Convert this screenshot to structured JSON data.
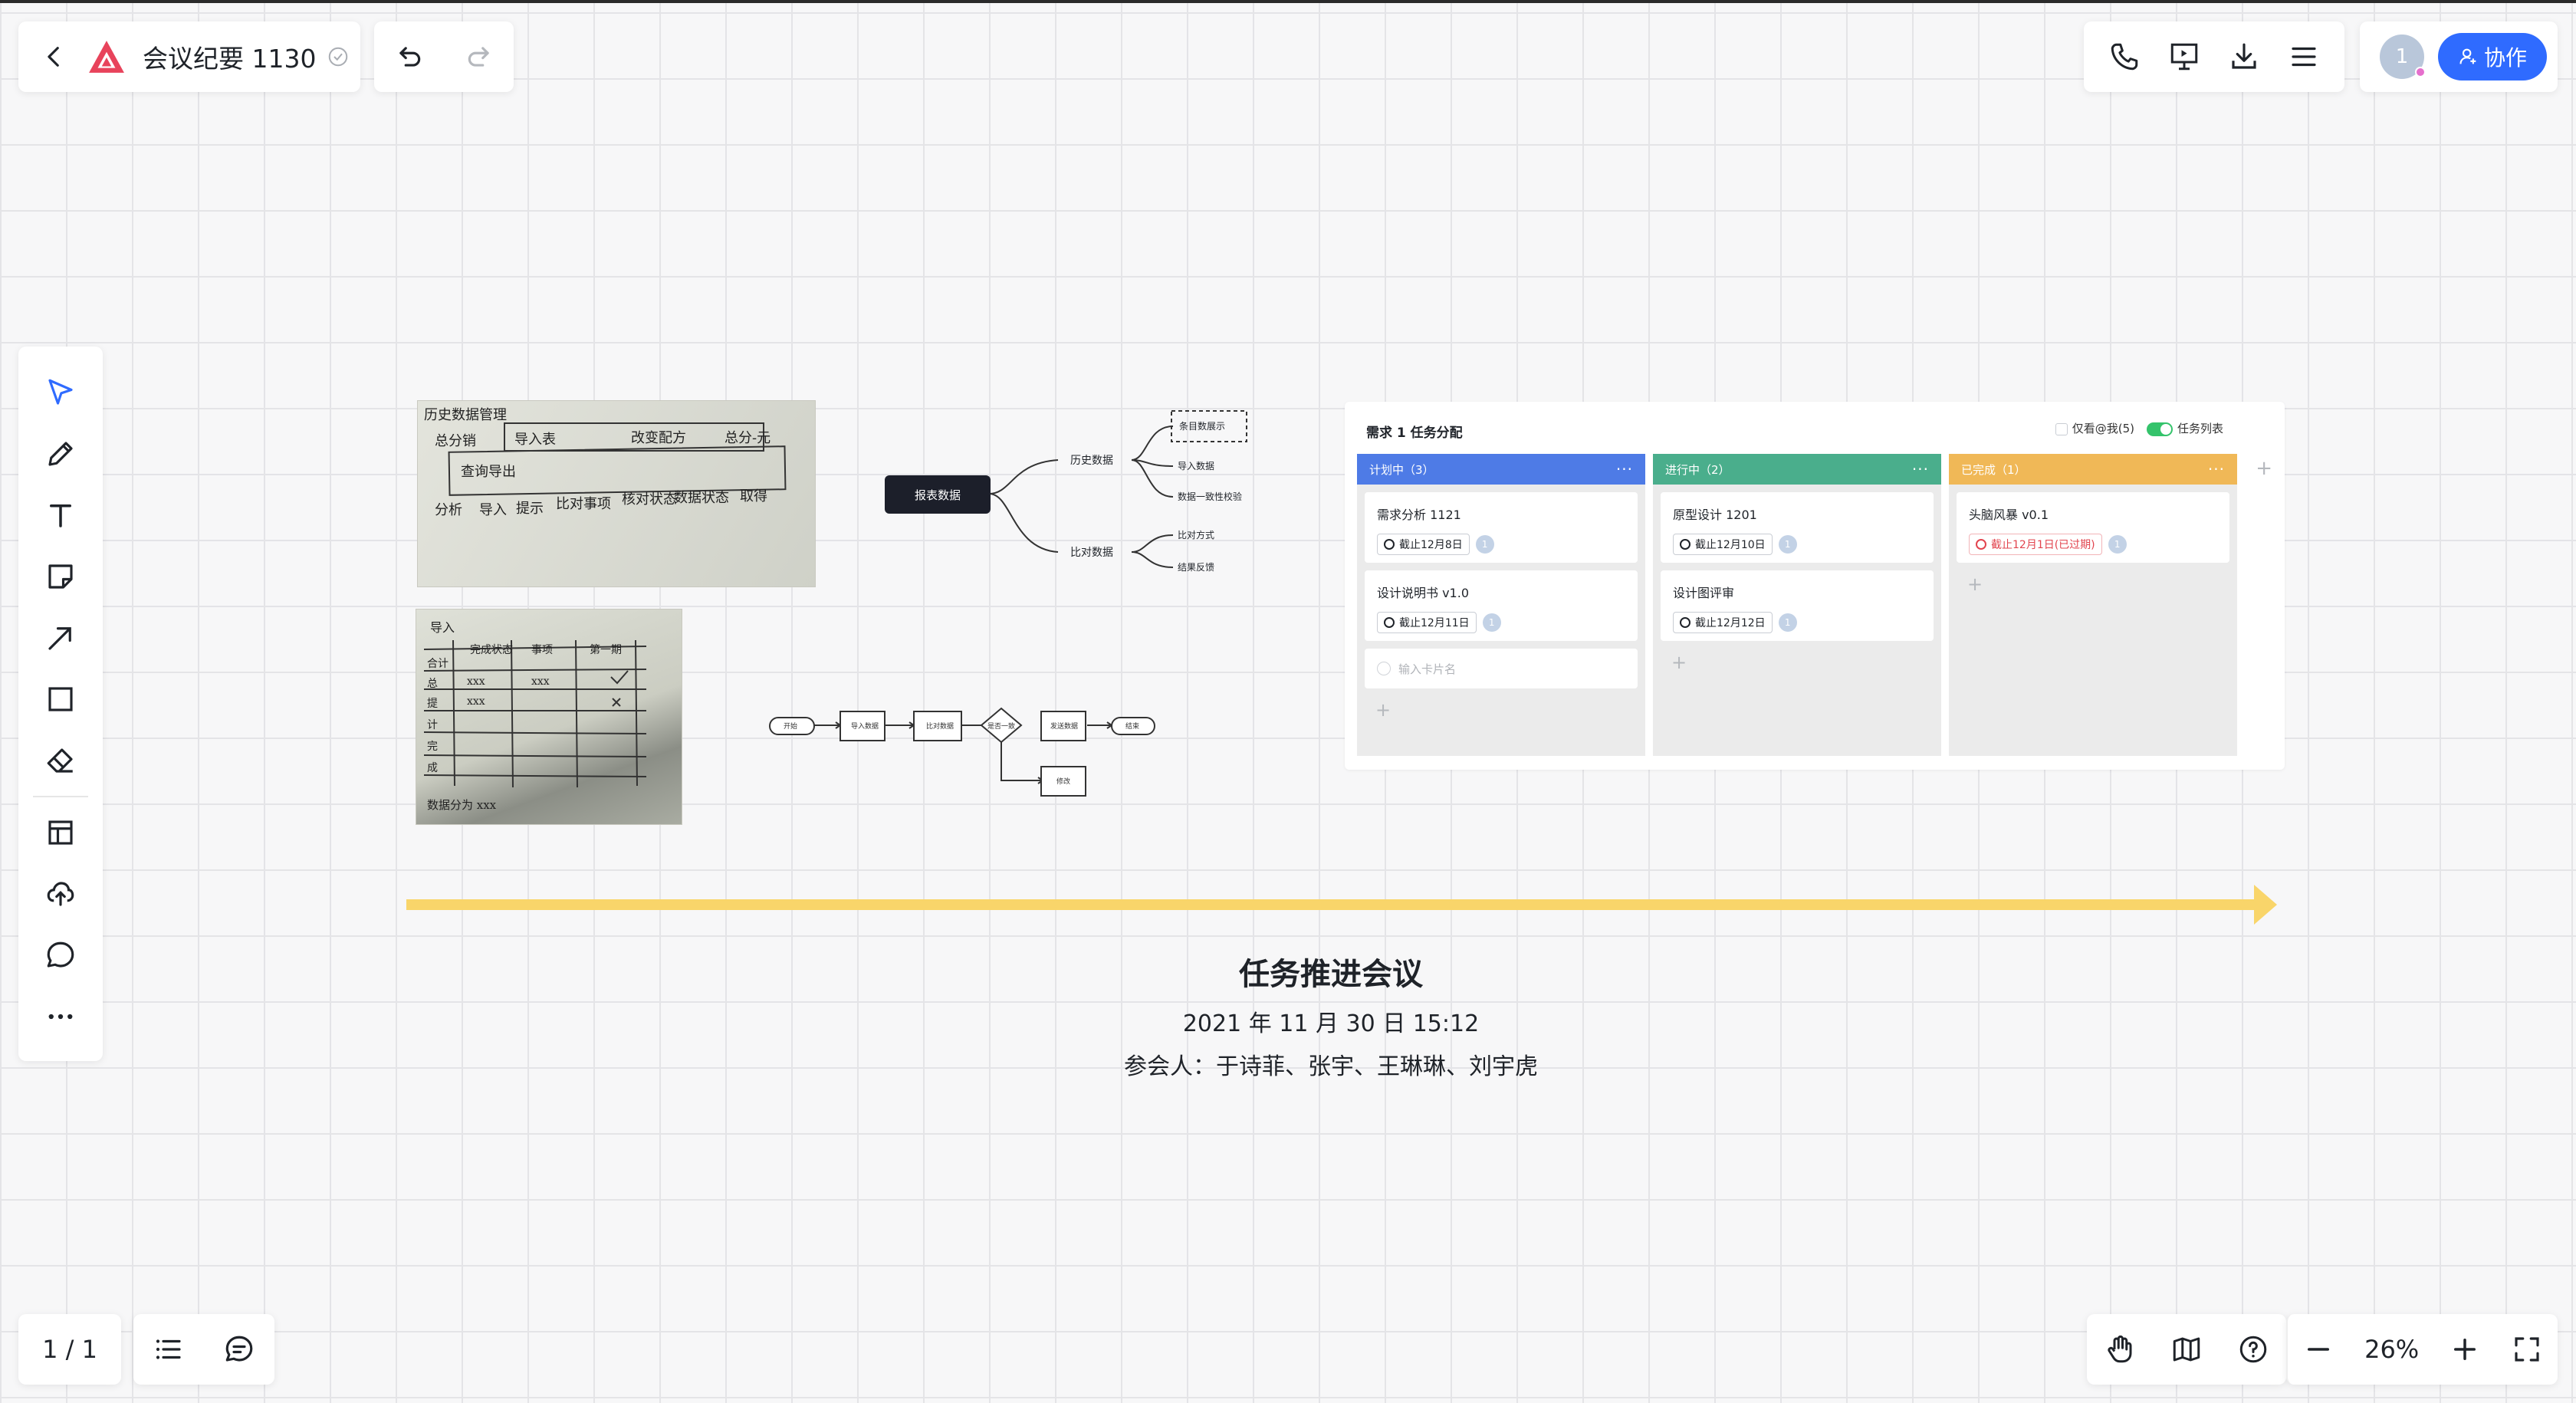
{
  "app": {
    "doc_title": "会议纪要 1130",
    "page_indicator": "1 / 1",
    "zoom_level": "26%",
    "accent_color": "#2f6bff",
    "logo_color": "#e8435b"
  },
  "collab": {
    "avatar_text": "1",
    "button_label": "协作"
  },
  "toolbar_icons": [
    "select-icon",
    "pen-icon",
    "text-icon",
    "sticky-note-icon",
    "arrow-icon",
    "rectangle-icon",
    "eraser-icon",
    "template-icon",
    "upload-icon",
    "comment-icon",
    "more-icon"
  ],
  "photo1": {
    "lines": [
      "历史数据管理",
      "总分销",
      "导入表",
      "改变配方",
      "总分-元",
      "查询导出",
      "分析",
      "导入",
      "提示",
      "比对事项",
      "核对状态",
      "数据状态",
      "取得"
    ]
  },
  "photo2": {
    "header": [
      "导入",
      "完成状态",
      "事项",
      "第一期"
    ],
    "rows": [
      "合计",
      "总",
      "提",
      "计",
      "完",
      "成"
    ],
    "marks": [
      "xxx",
      "xxx",
      "xxx"
    ],
    "footer": "数据分为 xxx"
  },
  "mindmap": {
    "root": "报表数据",
    "branches": [
      {
        "label": "历史数据",
        "children": [
          "条目数展示",
          "导入数据",
          "数据一致性校验"
        ]
      },
      {
        "label": "比对数据",
        "children": [
          "比对方式",
          "结果反馈"
        ]
      }
    ]
  },
  "flowchart": {
    "nodes": [
      "开始",
      "导入数据",
      "比对数据",
      "是否一致",
      "发送数据",
      "结束",
      "修改"
    ]
  },
  "kanban": {
    "title": "需求 1 任务分配",
    "filter_mine": "仅看@我(5)",
    "filter_list": "任务列表",
    "columns": [
      {
        "header": "计划中（3）",
        "color": "#4e7be6",
        "cards": [
          {
            "title": "需求分析 1121",
            "due": "截止12月8日",
            "assignee": "1"
          },
          {
            "title": "设计说明书 v1.0",
            "due": "截止12月11日",
            "assignee": "1"
          }
        ],
        "input_placeholder": "输入卡片名"
      },
      {
        "header": "进行中（2）",
        "color": "#4aae8c",
        "cards": [
          {
            "title": "原型设计 1201",
            "due": "截止12月10日",
            "assignee": "1"
          },
          {
            "title": "设计图评审",
            "due": "截止12月12日",
            "assignee": "1"
          }
        ]
      },
      {
        "header": "已完成（1）",
        "color": "#f0b857",
        "cards": [
          {
            "title": "头脑风暴 v0.1",
            "due": "截止12月1日(已过期)",
            "assignee": "1",
            "overdue_color": "#e2454f"
          }
        ]
      }
    ]
  },
  "timeline_color": "#f9d56a",
  "meeting": {
    "title": "任务推进会议",
    "date": "2021 年 11 月 30 日 15:12",
    "attendees": "参会人：于诗菲、张宇、王琳琳、刘宇虎"
  }
}
